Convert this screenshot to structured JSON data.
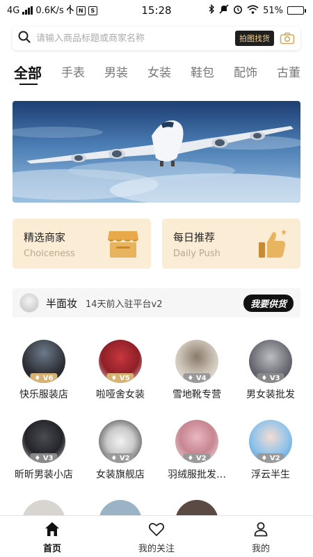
{
  "status_bar": {
    "network": "4G",
    "speed": "0.6K/s",
    "time": "15:28",
    "battery": "51%",
    "battery_level": 0.51,
    "icons": [
      "signal-icon",
      "usb-icon",
      "nfc-icon",
      "sim-icon",
      "bluetooth-icon",
      "mute-icon",
      "alarm-icon",
      "wifi-icon",
      "battery-icon"
    ]
  },
  "search": {
    "placeholder": "请输入商品标题或商家名称",
    "photo_button": "拍图找货"
  },
  "category_tabs": [
    {
      "label": "全部",
      "active": true
    },
    {
      "label": "手表"
    },
    {
      "label": "男装"
    },
    {
      "label": "女装"
    },
    {
      "label": "鞋包"
    },
    {
      "label": "配饰"
    },
    {
      "label": "古董"
    }
  ],
  "feature_cards": [
    {
      "title": "精选商家",
      "subtitle": "Choiceness",
      "icon": "shop-icon"
    },
    {
      "title": "每日推荐",
      "subtitle": "Daily Push",
      "icon": "thumbs-up-icon"
    }
  ],
  "notice": {
    "name": "半面妆",
    "text": "14天前入驻平台v2",
    "button": "我要供货"
  },
  "shops": [
    {
      "name": "快乐服装店",
      "level": "V6",
      "badge_color": "#d7b275"
    },
    {
      "name": "啦哑舍女装",
      "level": "V5",
      "badge_color": "#d7b275"
    },
    {
      "name": "雪地靴专营",
      "level": "V4",
      "badge_color": "#9a9a9a"
    },
    {
      "name": "男女装批发",
      "level": "V3",
      "badge_color": "#8a8a8a"
    },
    {
      "name": "昕昕男装小店",
      "level": "V3",
      "badge_color": "#8a8a8a"
    },
    {
      "name": "女装旗舰店",
      "level": "V2",
      "badge_color": "#9a9a9a"
    },
    {
      "name": "羽绒服批发…",
      "level": "V2",
      "badge_color": "#9a9a9a"
    },
    {
      "name": "浮云半生",
      "level": "V2",
      "badge_color": "#9a9a9a"
    }
  ],
  "bottom_nav": [
    {
      "label": "首页",
      "icon": "home-icon",
      "active": true
    },
    {
      "label": "我的关注",
      "icon": "heart-icon"
    },
    {
      "label": "我的",
      "icon": "user-icon"
    }
  ],
  "colors": {
    "accent_gold": "#d7b275",
    "card_bg": "#fbecd6",
    "dark": "#111111"
  }
}
